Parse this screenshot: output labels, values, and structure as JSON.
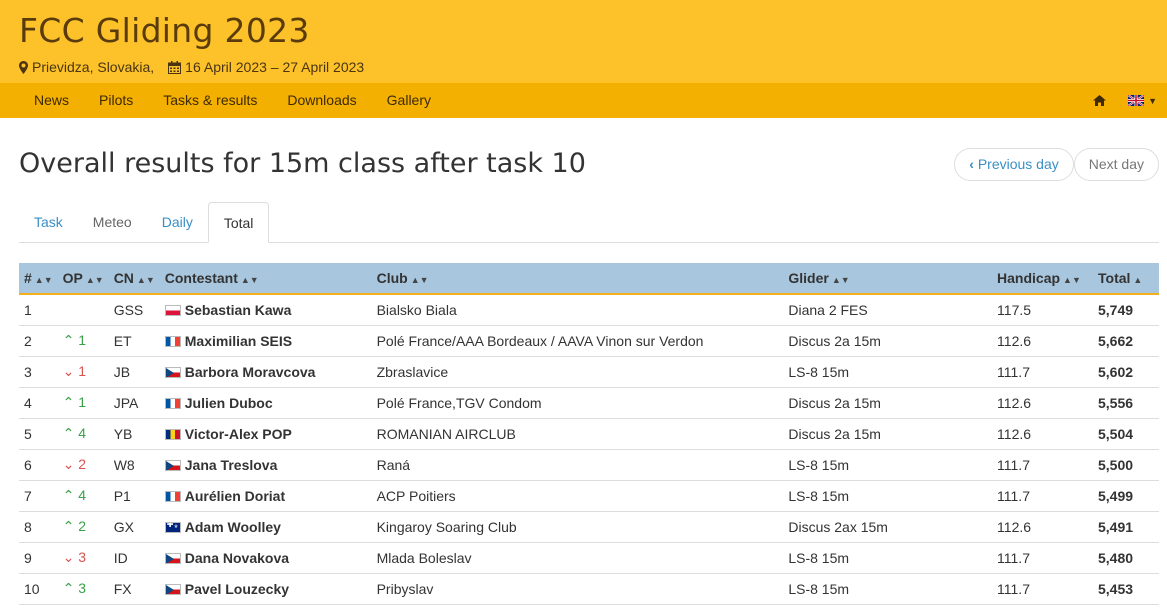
{
  "site": {
    "title": "FCC Gliding 2023",
    "location": "Prievidza, Slovakia,",
    "dates": "16 April 2023 – 27 April 2023"
  },
  "nav": {
    "items": [
      "News",
      "Pilots",
      "Tasks & results",
      "Downloads",
      "Gallery"
    ],
    "home_icon": "home-icon",
    "language_icon": "uk-flag-icon"
  },
  "page": {
    "title": "Overall results for 15m class after task 10",
    "prev_label": "Previous day",
    "next_label": "Next day"
  },
  "tabs": [
    {
      "label": "Task",
      "style": "link"
    },
    {
      "label": "Meteo",
      "style": "plain"
    },
    {
      "label": "Daily",
      "style": "link"
    },
    {
      "label": "Total",
      "style": "active"
    }
  ],
  "table": {
    "headers": [
      "#",
      "OP",
      "CN",
      "Contestant",
      "Club",
      "Glider",
      "Handicap",
      "Total"
    ],
    "rows": [
      {
        "rank": "1",
        "op_dir": "",
        "op": "",
        "cn": "GSS",
        "flag": "pl",
        "name": "Sebastian Kawa",
        "club": "Bialsko Biala",
        "glider": "Diana 2 FES",
        "handicap": "117.5",
        "total": "5,749"
      },
      {
        "rank": "2",
        "op_dir": "up",
        "op": "1",
        "cn": "ET",
        "flag": "fr",
        "name": "Maximilian SEIS",
        "club": "Polé France/AAA Bordeaux / AAVA Vinon sur Verdon",
        "glider": "Discus 2a 15m",
        "handicap": "112.6",
        "total": "5,662"
      },
      {
        "rank": "3",
        "op_dir": "down",
        "op": "1",
        "cn": "JB",
        "flag": "cz",
        "name": "Barbora Moravcova",
        "club": "Zbraslavice",
        "glider": "LS-8 15m",
        "handicap": "111.7",
        "total": "5,602"
      },
      {
        "rank": "4",
        "op_dir": "up",
        "op": "1",
        "cn": "JPA",
        "flag": "fr",
        "name": "Julien Duboc",
        "club": "Polé France,TGV Condom",
        "glider": "Discus 2a 15m",
        "handicap": "112.6",
        "total": "5,556"
      },
      {
        "rank": "5",
        "op_dir": "up",
        "op": "4",
        "cn": "YB",
        "flag": "ro",
        "name": "Victor-Alex POP",
        "club": "ROMANIAN AIRCLUB",
        "glider": "Discus 2a 15m",
        "handicap": "112.6",
        "total": "5,504"
      },
      {
        "rank": "6",
        "op_dir": "down",
        "op": "2",
        "cn": "W8",
        "flag": "cz",
        "name": "Jana Treslova",
        "club": "Raná",
        "glider": "LS-8 15m",
        "handicap": "111.7",
        "total": "5,500"
      },
      {
        "rank": "7",
        "op_dir": "up",
        "op": "4",
        "cn": "P1",
        "flag": "fr",
        "name": "Aurélien Doriat",
        "club": "ACP Poitiers",
        "glider": "LS-8 15m",
        "handicap": "111.7",
        "total": "5,499"
      },
      {
        "rank": "8",
        "op_dir": "up",
        "op": "2",
        "cn": "GX",
        "flag": "au",
        "name": "Adam Woolley",
        "club": "Kingaroy Soaring Club",
        "glider": "Discus 2ax 15m",
        "handicap": "112.6",
        "total": "5,491"
      },
      {
        "rank": "9",
        "op_dir": "down",
        "op": "3",
        "cn": "ID",
        "flag": "cz",
        "name": "Dana Novakova",
        "club": "Mlada Boleslav",
        "glider": "LS-8 15m",
        "handicap": "111.7",
        "total": "5,480"
      },
      {
        "rank": "10",
        "op_dir": "up",
        "op": "3",
        "cn": "FX",
        "flag": "cz",
        "name": "Pavel Louzecky",
        "club": "Pribyslav",
        "glider": "LS-8 15m",
        "handicap": "111.7",
        "total": "5,453"
      }
    ]
  },
  "colors": {
    "header_bg": "#fdc22a",
    "nav_bg": "#f4b000",
    "table_head_bg": "#a8c6dd",
    "link": "#3a8fc7"
  }
}
